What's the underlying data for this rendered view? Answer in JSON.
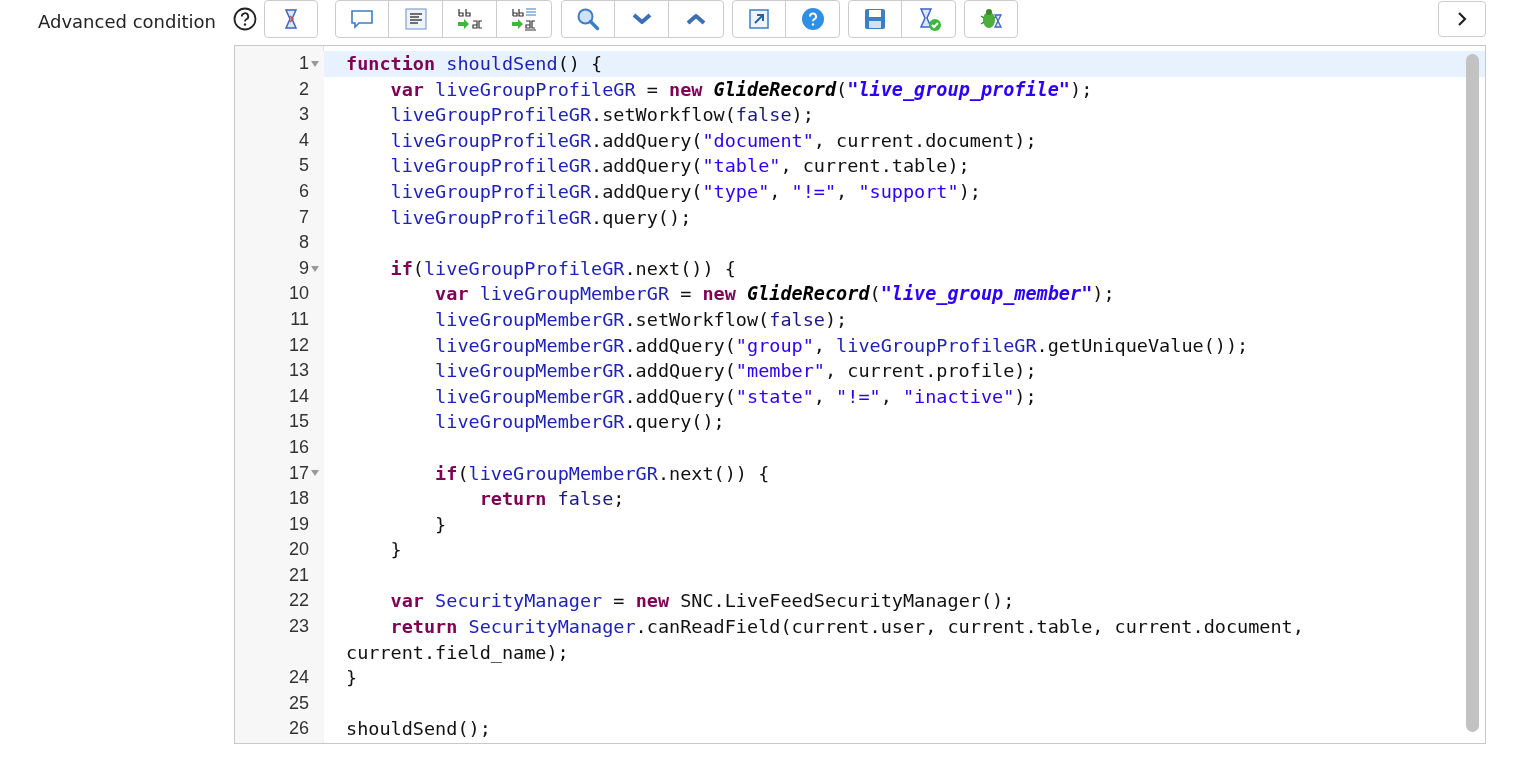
{
  "field_label": "Advanced condition",
  "editor": {
    "lines": [
      {
        "number": "1",
        "foldable": true,
        "active": true,
        "tokens": [
          {
            "kind": "keyword",
            "text": "function"
          },
          {
            "kind": "identifier",
            "text": " shouldSend"
          },
          {
            "kind": "plain",
            "text": "() {"
          }
        ]
      },
      {
        "number": "2",
        "foldable": false,
        "active": false,
        "tokens": [
          {
            "kind": "keyword",
            "text": "    var"
          },
          {
            "kind": "identifier",
            "text": " liveGroupProfileGR"
          },
          {
            "kind": "plain",
            "text": " = "
          },
          {
            "kind": "keyword",
            "text": "new"
          },
          {
            "kind": "class",
            "text": " GlideRecord"
          },
          {
            "kind": "plain",
            "text": "("
          },
          {
            "kind": "string_emphasis",
            "text": "\"live_group_profile\""
          },
          {
            "kind": "plain",
            "text": ");"
          }
        ]
      },
      {
        "number": "3",
        "foldable": false,
        "active": false,
        "tokens": [
          {
            "kind": "identifier",
            "text": "    liveGroupProfileGR"
          },
          {
            "kind": "plain",
            "text": ".setWorkflow("
          },
          {
            "kind": "literal",
            "text": "false"
          },
          {
            "kind": "plain",
            "text": ");"
          }
        ]
      },
      {
        "number": "4",
        "foldable": false,
        "active": false,
        "tokens": [
          {
            "kind": "identifier",
            "text": "    liveGroupProfileGR"
          },
          {
            "kind": "plain",
            "text": ".addQuery("
          },
          {
            "kind": "string",
            "text": "\"document\""
          },
          {
            "kind": "plain",
            "text": ", current.document);"
          }
        ]
      },
      {
        "number": "5",
        "foldable": false,
        "active": false,
        "tokens": [
          {
            "kind": "identifier",
            "text": "    liveGroupProfileGR"
          },
          {
            "kind": "plain",
            "text": ".addQuery("
          },
          {
            "kind": "string",
            "text": "\"table\""
          },
          {
            "kind": "plain",
            "text": ", current.table);"
          }
        ]
      },
      {
        "number": "6",
        "foldable": false,
        "active": false,
        "tokens": [
          {
            "kind": "identifier",
            "text": "    liveGroupProfileGR"
          },
          {
            "kind": "plain",
            "text": ".addQuery("
          },
          {
            "kind": "string",
            "text": "\"type\""
          },
          {
            "kind": "plain",
            "text": ", "
          },
          {
            "kind": "string",
            "text": "\"!=\""
          },
          {
            "kind": "plain",
            "text": ", "
          },
          {
            "kind": "string",
            "text": "\"support\""
          },
          {
            "kind": "plain",
            "text": ");"
          }
        ]
      },
      {
        "number": "7",
        "foldable": false,
        "active": false,
        "tokens": [
          {
            "kind": "identifier",
            "text": "    liveGroupProfileGR"
          },
          {
            "kind": "plain",
            "text": ".query();"
          }
        ]
      },
      {
        "number": "8",
        "foldable": false,
        "active": false
      },
      {
        "number": "9",
        "foldable": true,
        "active": false,
        "tokens": [
          {
            "kind": "keyword",
            "text": "    if"
          },
          {
            "kind": "plain",
            "text": "("
          },
          {
            "kind": "identifier",
            "text": "liveGroupProfileGR"
          },
          {
            "kind": "plain",
            "text": ".next()) {"
          }
        ]
      },
      {
        "number": "10",
        "foldable": false,
        "active": false,
        "tokens": [
          {
            "kind": "keyword",
            "text": "        var"
          },
          {
            "kind": "identifier",
            "text": " liveGroupMemberGR"
          },
          {
            "kind": "plain",
            "text": " = "
          },
          {
            "kind": "keyword",
            "text": "new"
          },
          {
            "kind": "class",
            "text": " GlideRecord"
          },
          {
            "kind": "plain",
            "text": "("
          },
          {
            "kind": "string_emphasis",
            "text": "\"live_group_member\""
          },
          {
            "kind": "plain",
            "text": ");"
          }
        ]
      },
      {
        "number": "11",
        "foldable": false,
        "active": false,
        "tokens": [
          {
            "kind": "identifier",
            "text": "        liveGroupMemberGR"
          },
          {
            "kind": "plain",
            "text": ".setWorkflow("
          },
          {
            "kind": "literal",
            "text": "false"
          },
          {
            "kind": "plain",
            "text": ");"
          }
        ]
      },
      {
        "number": "12",
        "foldable": false,
        "active": false,
        "tokens": [
          {
            "kind": "identifier",
            "text": "        liveGroupMemberGR"
          },
          {
            "kind": "plain",
            "text": ".addQuery("
          },
          {
            "kind": "string",
            "text": "\"group\""
          },
          {
            "kind": "plain",
            "text": ", "
          },
          {
            "kind": "identifier",
            "text": "liveGroupProfileGR"
          },
          {
            "kind": "plain",
            "text": ".getUniqueValue());"
          }
        ]
      },
      {
        "number": "13",
        "foldable": false,
        "active": false,
        "tokens": [
          {
            "kind": "identifier",
            "text": "        liveGroupMemberGR"
          },
          {
            "kind": "plain",
            "text": ".addQuery("
          },
          {
            "kind": "string",
            "text": "\"member\""
          },
          {
            "kind": "plain",
            "text": ", current.profile);"
          }
        ]
      },
      {
        "number": "14",
        "foldable": false,
        "active": false,
        "tokens": [
          {
            "kind": "identifier",
            "text": "        liveGroupMemberGR"
          },
          {
            "kind": "plain",
            "text": ".addQuery("
          },
          {
            "kind": "string",
            "text": "\"state\""
          },
          {
            "kind": "plain",
            "text": ", "
          },
          {
            "kind": "string",
            "text": "\"!=\""
          },
          {
            "kind": "plain",
            "text": ", "
          },
          {
            "kind": "string",
            "text": "\"inactive\""
          },
          {
            "kind": "plain",
            "text": ");"
          }
        ]
      },
      {
        "number": "15",
        "foldable": false,
        "active": false,
        "tokens": [
          {
            "kind": "identifier",
            "text": "        liveGroupMemberGR"
          },
          {
            "kind": "plain",
            "text": ".query();"
          }
        ]
      },
      {
        "number": "16",
        "foldable": false,
        "active": false
      },
      {
        "number": "17",
        "foldable": true,
        "active": false,
        "tokens": [
          {
            "kind": "keyword",
            "text": "        if"
          },
          {
            "kind": "plain",
            "text": "("
          },
          {
            "kind": "identifier",
            "text": "liveGroupMemberGR"
          },
          {
            "kind": "plain",
            "text": ".next()) {"
          }
        ]
      },
      {
        "number": "18",
        "foldable": false,
        "active": false,
        "tokens": [
          {
            "kind": "keyword",
            "text": "            return"
          },
          {
            "kind": "literal",
            "text": " false"
          },
          {
            "kind": "plain",
            "text": ";"
          }
        ]
      },
      {
        "number": "19",
        "foldable": false,
        "active": false,
        "tokens": [
          {
            "kind": "plain",
            "text": "        }"
          }
        ]
      },
      {
        "number": "20",
        "foldable": false,
        "active": false,
        "tokens": [
          {
            "kind": "plain",
            "text": "    }"
          }
        ]
      },
      {
        "number": "21",
        "foldable": false,
        "active": false
      },
      {
        "number": "22",
        "foldable": false,
        "active": false,
        "tokens": [
          {
            "kind": "keyword",
            "text": "    var"
          },
          {
            "kind": "identifier",
            "text": " SecurityManager"
          },
          {
            "kind": "plain",
            "text": " = "
          },
          {
            "kind": "keyword",
            "text": "new"
          },
          {
            "kind": "plain",
            "text": " SNC.LiveFeedSecurityManager();"
          }
        ]
      },
      {
        "number": "23",
        "foldable": false,
        "active": false,
        "tokens": [
          {
            "kind": "keyword",
            "text": "    return"
          },
          {
            "kind": "identifier",
            "text": " SecurityManager"
          },
          {
            "kind": "plain",
            "text": ".canReadField(current.user, current.table, current.document, current.field_name);"
          }
        ]
      },
      {
        "number": "24",
        "foldable": false,
        "active": false,
        "tokens": [
          {
            "kind": "plain",
            "text": "}"
          }
        ]
      },
      {
        "number": "25",
        "foldable": false,
        "active": false
      },
      {
        "number": "26",
        "foldable": false,
        "active": false,
        "tokens": [
          {
            "kind": "plain",
            "text": "shouldSend();"
          }
        ]
      }
    ]
  }
}
